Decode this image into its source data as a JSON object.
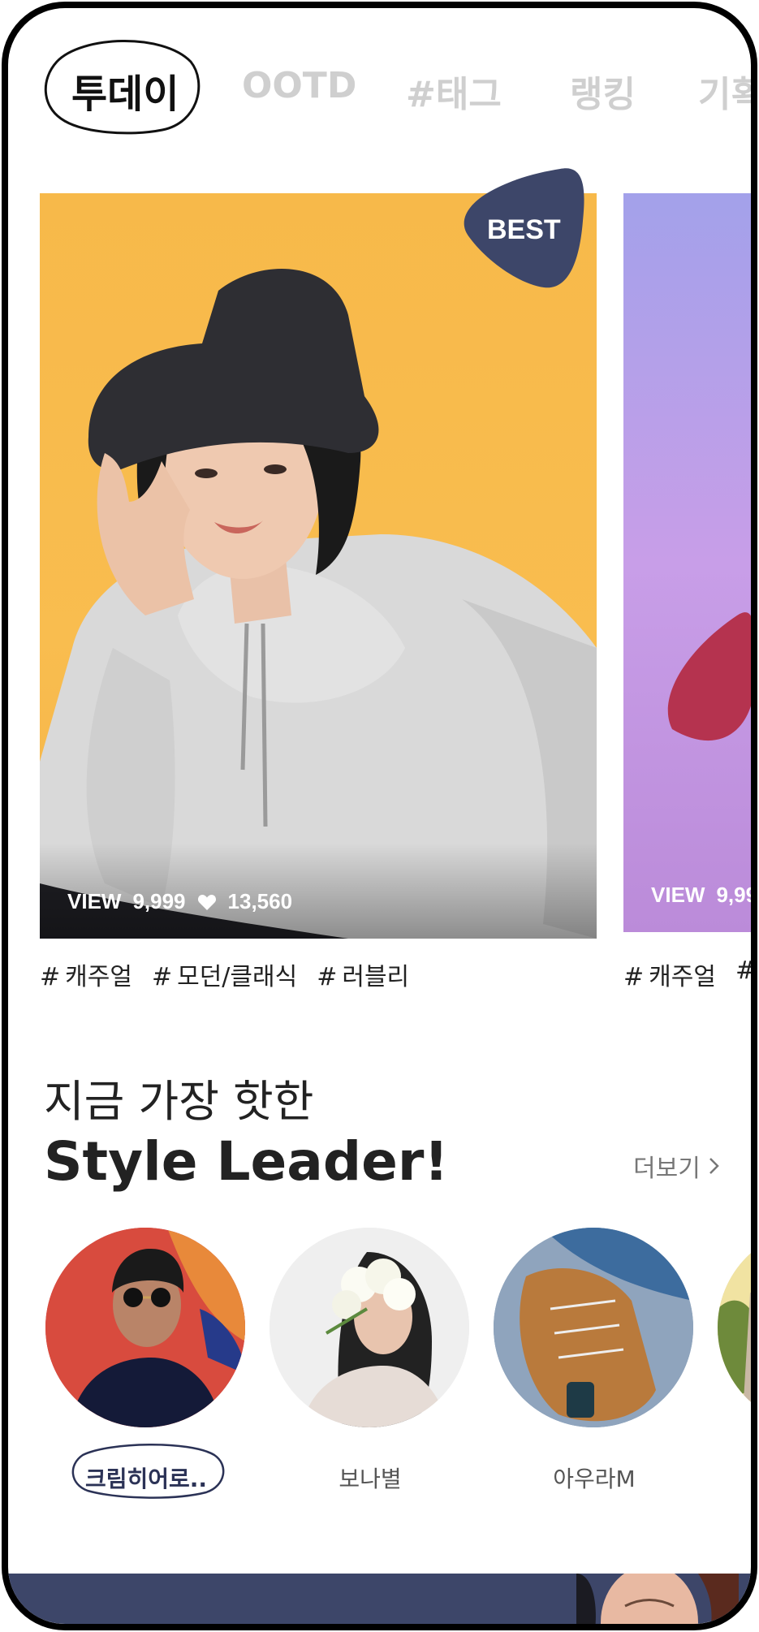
{
  "tabs": [
    {
      "label": "투데이",
      "active": true
    },
    {
      "label": "OOTD"
    },
    {
      "label": "#태그"
    },
    {
      "label": "랭킹"
    },
    {
      "label": "기획"
    }
  ],
  "cards": [
    {
      "badge": "BEST",
      "views_label": "VIEW",
      "views": "9,999",
      "likes": "13,560",
      "tags": [
        "캐주얼",
        "모던/클래식",
        "러블리"
      ]
    },
    {
      "views_label": "VIEW",
      "views": "9,99",
      "tags": [
        "캐주얼",
        ""
      ]
    }
  ],
  "style_leader": {
    "subtitle": "지금 가장 핫한",
    "title": "Style Leader!",
    "more_label": "더보기",
    "leaders": [
      {
        "name": "크림히어로..",
        "selected": true
      },
      {
        "name": "보나별"
      },
      {
        "name": "아우라M"
      }
    ]
  },
  "colors": {
    "accent_navy": "#3d4669",
    "card1_bg": "#f9bd4f",
    "card2_bg": "#b9a0e6",
    "inactive_tab": "#cfcfcf"
  }
}
